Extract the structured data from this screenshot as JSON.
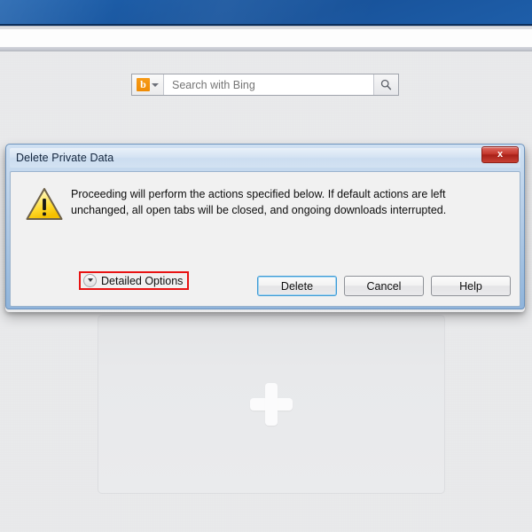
{
  "browser": {
    "search": {
      "engine_icon": "bing-logo-icon",
      "engine_letter": "b",
      "dropdown_icon": "chevron-down-icon",
      "placeholder": "Search with Bing",
      "value": "",
      "go_icon": "search-icon"
    },
    "speed_dial": {
      "add_icon": "plus-icon",
      "tile_label": ""
    }
  },
  "dialog": {
    "title": "Delete Private Data",
    "close_label": "x",
    "close_icon": "close-icon",
    "warning_icon": "warning-triangle-icon",
    "message": "Proceeding will perform the actions specified below. If default actions are left unchanged, all open tabs will be closed, and ongoing downloads interrupted.",
    "detailed_options": {
      "label": "Detailed Options",
      "toggle_icon": "chevron-down-circle-icon",
      "highlight_color": "#e81313",
      "expanded": false
    },
    "buttons": [
      {
        "label": "Delete",
        "default": true
      },
      {
        "label": "Cancel",
        "default": false
      },
      {
        "label": "Help",
        "default": false
      }
    ]
  },
  "colors": {
    "titlebar_blue": "#1a57a0",
    "dialog_frame": "#8fb4db",
    "close_red": "#c4372c",
    "annotation_red": "#e81313",
    "warning_yellow": "#ffe14d"
  }
}
